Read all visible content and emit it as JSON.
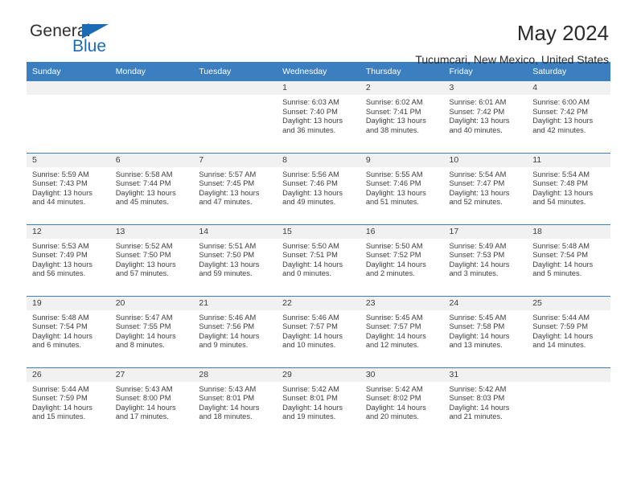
{
  "brand": {
    "name_part1": "General",
    "name_part2": "Blue",
    "triangle_color": "#1b6cb5"
  },
  "header": {
    "title": "May 2024",
    "subtitle": "Tucumcari, New Mexico, United States",
    "header_bg": "#3c7fc1",
    "daynum_bg": "#f1f1f1"
  },
  "weekdays": [
    "Sunday",
    "Monday",
    "Tuesday",
    "Wednesday",
    "Thursday",
    "Friday",
    "Saturday"
  ],
  "labels": {
    "sunrise": "Sunrise:",
    "sunset": "Sunset:",
    "daylight": "Daylight:"
  },
  "weeks": [
    [
      {
        "day": "",
        "empty": true
      },
      {
        "day": "",
        "empty": true
      },
      {
        "day": "",
        "empty": true
      },
      {
        "day": "1",
        "sunrise": "Sunrise: 6:03 AM",
        "sunset": "Sunset: 7:40 PM",
        "daylight": "Daylight: 13 hours and 36 minutes."
      },
      {
        "day": "2",
        "sunrise": "Sunrise: 6:02 AM",
        "sunset": "Sunset: 7:41 PM",
        "daylight": "Daylight: 13 hours and 38 minutes."
      },
      {
        "day": "3",
        "sunrise": "Sunrise: 6:01 AM",
        "sunset": "Sunset: 7:42 PM",
        "daylight": "Daylight: 13 hours and 40 minutes."
      },
      {
        "day": "4",
        "sunrise": "Sunrise: 6:00 AM",
        "sunset": "Sunset: 7:42 PM",
        "daylight": "Daylight: 13 hours and 42 minutes."
      }
    ],
    [
      {
        "day": "5",
        "sunrise": "Sunrise: 5:59 AM",
        "sunset": "Sunset: 7:43 PM",
        "daylight": "Daylight: 13 hours and 44 minutes."
      },
      {
        "day": "6",
        "sunrise": "Sunrise: 5:58 AM",
        "sunset": "Sunset: 7:44 PM",
        "daylight": "Daylight: 13 hours and 45 minutes."
      },
      {
        "day": "7",
        "sunrise": "Sunrise: 5:57 AM",
        "sunset": "Sunset: 7:45 PM",
        "daylight": "Daylight: 13 hours and 47 minutes."
      },
      {
        "day": "8",
        "sunrise": "Sunrise: 5:56 AM",
        "sunset": "Sunset: 7:46 PM",
        "daylight": "Daylight: 13 hours and 49 minutes."
      },
      {
        "day": "9",
        "sunrise": "Sunrise: 5:55 AM",
        "sunset": "Sunset: 7:46 PM",
        "daylight": "Daylight: 13 hours and 51 minutes."
      },
      {
        "day": "10",
        "sunrise": "Sunrise: 5:54 AM",
        "sunset": "Sunset: 7:47 PM",
        "daylight": "Daylight: 13 hours and 52 minutes."
      },
      {
        "day": "11",
        "sunrise": "Sunrise: 5:54 AM",
        "sunset": "Sunset: 7:48 PM",
        "daylight": "Daylight: 13 hours and 54 minutes."
      }
    ],
    [
      {
        "day": "12",
        "sunrise": "Sunrise: 5:53 AM",
        "sunset": "Sunset: 7:49 PM",
        "daylight": "Daylight: 13 hours and 56 minutes."
      },
      {
        "day": "13",
        "sunrise": "Sunrise: 5:52 AM",
        "sunset": "Sunset: 7:50 PM",
        "daylight": "Daylight: 13 hours and 57 minutes."
      },
      {
        "day": "14",
        "sunrise": "Sunrise: 5:51 AM",
        "sunset": "Sunset: 7:50 PM",
        "daylight": "Daylight: 13 hours and 59 minutes."
      },
      {
        "day": "15",
        "sunrise": "Sunrise: 5:50 AM",
        "sunset": "Sunset: 7:51 PM",
        "daylight": "Daylight: 14 hours and 0 minutes."
      },
      {
        "day": "16",
        "sunrise": "Sunrise: 5:50 AM",
        "sunset": "Sunset: 7:52 PM",
        "daylight": "Daylight: 14 hours and 2 minutes."
      },
      {
        "day": "17",
        "sunrise": "Sunrise: 5:49 AM",
        "sunset": "Sunset: 7:53 PM",
        "daylight": "Daylight: 14 hours and 3 minutes."
      },
      {
        "day": "18",
        "sunrise": "Sunrise: 5:48 AM",
        "sunset": "Sunset: 7:54 PM",
        "daylight": "Daylight: 14 hours and 5 minutes."
      }
    ],
    [
      {
        "day": "19",
        "sunrise": "Sunrise: 5:48 AM",
        "sunset": "Sunset: 7:54 PM",
        "daylight": "Daylight: 14 hours and 6 minutes."
      },
      {
        "day": "20",
        "sunrise": "Sunrise: 5:47 AM",
        "sunset": "Sunset: 7:55 PM",
        "daylight": "Daylight: 14 hours and 8 minutes."
      },
      {
        "day": "21",
        "sunrise": "Sunrise: 5:46 AM",
        "sunset": "Sunset: 7:56 PM",
        "daylight": "Daylight: 14 hours and 9 minutes."
      },
      {
        "day": "22",
        "sunrise": "Sunrise: 5:46 AM",
        "sunset": "Sunset: 7:57 PM",
        "daylight": "Daylight: 14 hours and 10 minutes."
      },
      {
        "day": "23",
        "sunrise": "Sunrise: 5:45 AM",
        "sunset": "Sunset: 7:57 PM",
        "daylight": "Daylight: 14 hours and 12 minutes."
      },
      {
        "day": "24",
        "sunrise": "Sunrise: 5:45 AM",
        "sunset": "Sunset: 7:58 PM",
        "daylight": "Daylight: 14 hours and 13 minutes."
      },
      {
        "day": "25",
        "sunrise": "Sunrise: 5:44 AM",
        "sunset": "Sunset: 7:59 PM",
        "daylight": "Daylight: 14 hours and 14 minutes."
      }
    ],
    [
      {
        "day": "26",
        "sunrise": "Sunrise: 5:44 AM",
        "sunset": "Sunset: 7:59 PM",
        "daylight": "Daylight: 14 hours and 15 minutes."
      },
      {
        "day": "27",
        "sunrise": "Sunrise: 5:43 AM",
        "sunset": "Sunset: 8:00 PM",
        "daylight": "Daylight: 14 hours and 17 minutes."
      },
      {
        "day": "28",
        "sunrise": "Sunrise: 5:43 AM",
        "sunset": "Sunset: 8:01 PM",
        "daylight": "Daylight: 14 hours and 18 minutes."
      },
      {
        "day": "29",
        "sunrise": "Sunrise: 5:42 AM",
        "sunset": "Sunset: 8:01 PM",
        "daylight": "Daylight: 14 hours and 19 minutes."
      },
      {
        "day": "30",
        "sunrise": "Sunrise: 5:42 AM",
        "sunset": "Sunset: 8:02 PM",
        "daylight": "Daylight: 14 hours and 20 minutes."
      },
      {
        "day": "31",
        "sunrise": "Sunrise: 5:42 AM",
        "sunset": "Sunset: 8:03 PM",
        "daylight": "Daylight: 14 hours and 21 minutes."
      },
      {
        "day": "",
        "empty": true
      }
    ]
  ]
}
